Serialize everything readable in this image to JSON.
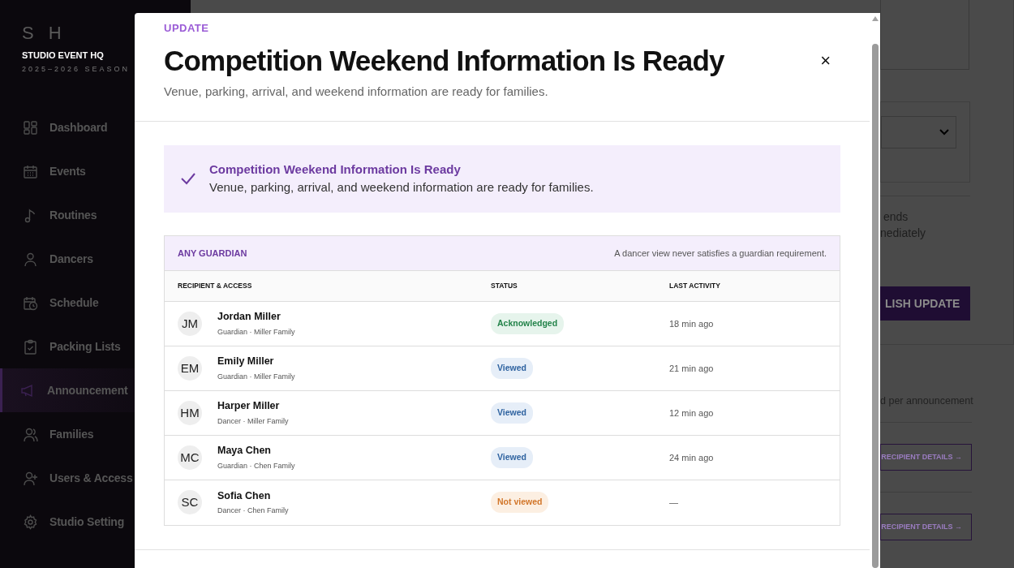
{
  "sidebar": {
    "logo": "S H",
    "studio": "STUDIO EVENT HQ",
    "season": "2025–2026 SEASON",
    "items": [
      {
        "label": "Dashboard",
        "selected": false
      },
      {
        "label": "Events",
        "selected": false
      },
      {
        "label": "Routines",
        "selected": false
      },
      {
        "label": "Dancers",
        "selected": false
      },
      {
        "label": "Schedule",
        "selected": false
      },
      {
        "label": "Packing Lists",
        "selected": false
      },
      {
        "label": "Announcement",
        "selected": true
      },
      {
        "label": "Families",
        "selected": false
      },
      {
        "label": "Users & Access",
        "selected": false
      },
      {
        "label": "Studio Setting",
        "selected": false
      }
    ]
  },
  "background": {
    "text_lines": [
      "ends",
      "nediately"
    ],
    "publish_button": "LISH UPDATE",
    "note": "d per announcement",
    "detail_buttons": [
      "RECIPIENT DETAILS →",
      "RECIPIENT DETAILS →"
    ]
  },
  "modal": {
    "eyebrow": "UPDATE",
    "title": "Competition Weekend Information Is Ready",
    "subtitle": "Venue, parking, arrival, and weekend information are ready for families.",
    "close": "×",
    "notice": {
      "title": "Competition Weekend Information Is Ready",
      "text": "Venue, parking, arrival, and weekend information are ready for families."
    },
    "table": {
      "group": "ANY GUARDIAN",
      "group_note": "A dancer view never satisfies a guardian requirement.",
      "columns": [
        "RECIPIENT & ACCESS",
        "STATUS",
        "LAST ACTIVITY"
      ],
      "rows": [
        {
          "initials": "JM",
          "name": "Jordan Miller",
          "access": "Guardian · Miller Family",
          "status": "Acknowledged",
          "kind": "acknowledged",
          "last_activity": "18 min ago"
        },
        {
          "initials": "EM",
          "name": "Emily Miller",
          "access": "Guardian · Miller Family",
          "status": "Viewed",
          "kind": "viewed",
          "last_activity": "21 min ago"
        },
        {
          "initials": "HM",
          "name": "Harper Miller",
          "access": "Dancer · Miller Family",
          "status": "Viewed",
          "kind": "viewed",
          "last_activity": "12 min ago"
        },
        {
          "initials": "MC",
          "name": "Maya Chen",
          "access": "Guardian · Chen Family",
          "status": "Viewed",
          "kind": "viewed",
          "last_activity": "24 min ago"
        },
        {
          "initials": "SC",
          "name": "Sofia Chen",
          "access": "Dancer · Chen Family",
          "status": "Not viewed",
          "kind": "not_viewed",
          "last_activity": "—"
        }
      ]
    }
  }
}
